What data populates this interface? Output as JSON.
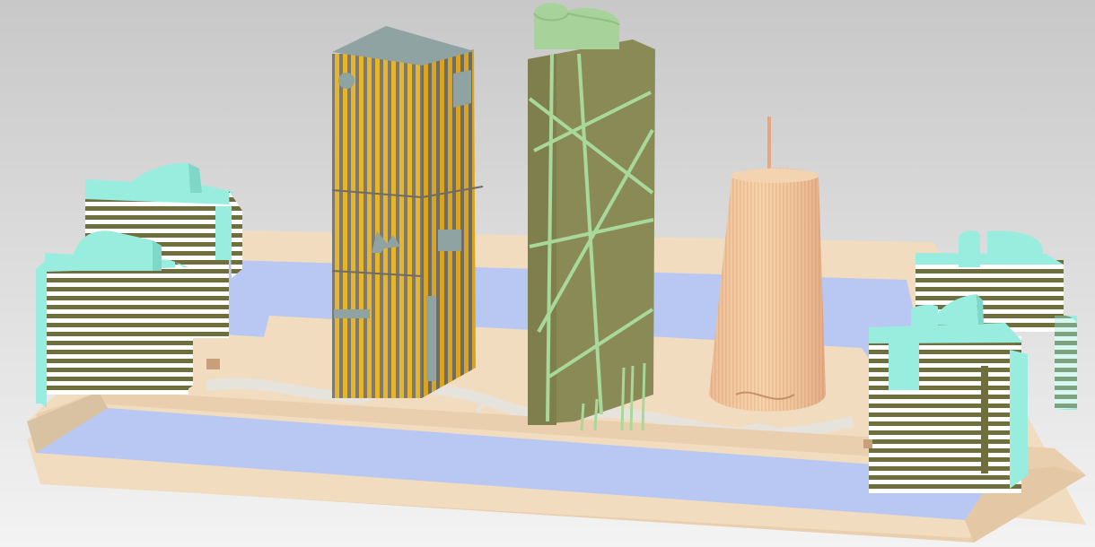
{
  "scene": {
    "title": "",
    "colors": {
      "sky_top": "#c9c9c9",
      "sky_bottom": "#efefef",
      "plaza": "#f2dcc0",
      "plaza_edge": "#e9cfae",
      "water": "#b9c8f2",
      "water_dark": "#a7b8ea",
      "path": "#e6e3dd",
      "yellow_tower": "#e7b52a",
      "yellow_stripe": "#7c7a72",
      "tower_roof": "#8ea3a2",
      "green_tower": "#8a8a57",
      "green_lines": "#a8d89a",
      "green_top": "#a7d39a",
      "cone_tower": "#efc49f",
      "cone_stripe": "#e2a880",
      "block_light": "#ffffff",
      "block_stripe": "#6f6f3d",
      "cyan": "#98eddf"
    },
    "objects": [
      {
        "name": "left-back-block",
        "kind": "striped-building"
      },
      {
        "name": "left-front-block",
        "kind": "striped-building"
      },
      {
        "name": "yellow-tower",
        "kind": "striped-tower"
      },
      {
        "name": "green-tower",
        "kind": "slanted-tower"
      },
      {
        "name": "cone-tower",
        "kind": "cone"
      },
      {
        "name": "right-back-block",
        "kind": "striped-building"
      },
      {
        "name": "right-front-block",
        "kind": "striped-building"
      }
    ]
  }
}
